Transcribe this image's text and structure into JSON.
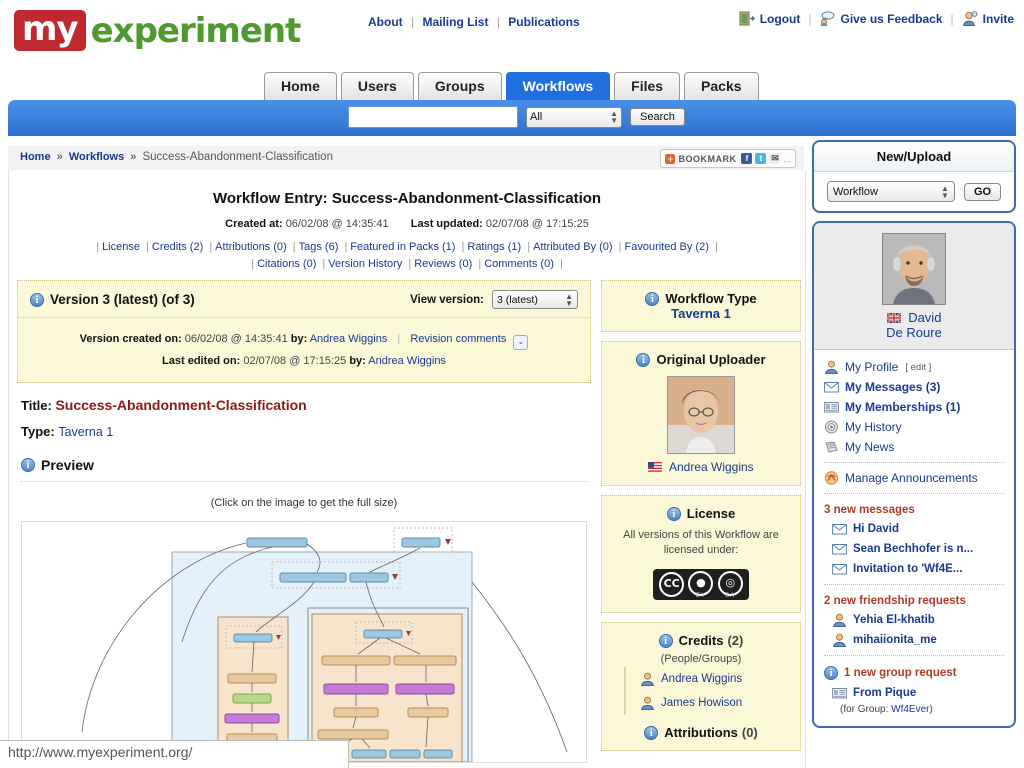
{
  "header": {
    "logo_my": "my",
    "logo_experiment": "experiment",
    "center_nav": [
      "About",
      "Mailing List",
      "Publications"
    ],
    "right_nav": [
      {
        "label": "Logout",
        "icon": "logout-icon"
      },
      {
        "label": "Give us Feedback",
        "icon": "feedback-icon"
      },
      {
        "label": "Invite",
        "icon": "invite-icon"
      }
    ]
  },
  "tabs": [
    {
      "label": "Home",
      "active": false
    },
    {
      "label": "Users",
      "active": false
    },
    {
      "label": "Groups",
      "active": false
    },
    {
      "label": "Workflows",
      "active": true
    },
    {
      "label": "Files",
      "active": false
    },
    {
      "label": "Packs",
      "active": false
    }
  ],
  "search": {
    "value": "",
    "placeholder": "",
    "scope": "All",
    "button": "Search"
  },
  "breadcrumb": {
    "home": "Home",
    "section": "Workflows",
    "current": "Success-Abandonment-Classification",
    "separator": "»"
  },
  "bookmark": {
    "label": "BOOKMARK",
    "plus": "+",
    "facebook": "f",
    "twitter": "t",
    "email": "✉",
    "more": "..."
  },
  "entry": {
    "heading": "Workflow Entry: Success-Abandonment-Classification",
    "created_label": "Created at:",
    "created_value": "06/02/08 @ 14:35:41",
    "updated_label": "Last updated:",
    "updated_value": "02/07/08 @ 17:15:25",
    "meta_links_row1": [
      "License",
      "Credits (2)",
      "Attributions (0)",
      "Tags (6)",
      "Featured in Packs (1)",
      "Ratings (1)",
      "Attributed By (0)",
      "Favourited By (2)"
    ],
    "meta_links_row2": [
      "Citations (0)",
      "Version History",
      "Reviews (0)",
      "Comments (0)"
    ]
  },
  "version_panel": {
    "title": "Version 3 (latest) (of 3)",
    "view_version_label": "View version:",
    "selected_version": "3 (latest)",
    "created_label": "Version created on:",
    "created_value": "06/02/08 @ 14:35:41",
    "created_by_label": "by:",
    "created_by": "Andrea Wiggins",
    "revision_comments": "Revision comments",
    "edited_label": "Last edited on:",
    "edited_value": "02/07/08 @ 17:15:25",
    "edited_by_label": "by:",
    "edited_by": "Andrea Wiggins"
  },
  "details": {
    "title_label": "Title:",
    "title_value": "Success-Abandonment-Classification",
    "type_label": "Type:",
    "type_value": "Taverna 1",
    "preview_heading": "Preview",
    "click_hint": "(Click on the image to get the full size)"
  },
  "side_panels": {
    "workflow_type": {
      "heading": "Workflow Type",
      "value": "Taverna 1"
    },
    "original_uploader": {
      "heading": "Original Uploader",
      "name": "Andrea Wiggins",
      "flag": "us-flag-icon"
    },
    "license": {
      "heading": "License",
      "text": "All versions of this Workflow are licensed under:",
      "badge": "CC",
      "badge_by": "BY",
      "badge_sa": "SA"
    },
    "credits": {
      "heading": "Credits",
      "count": "(2)",
      "subtitle": "(People/Groups)",
      "people": [
        "Andrea Wiggins",
        "James Howison"
      ]
    },
    "attributions": {
      "heading": "Attributions",
      "count": "(0)"
    }
  },
  "sidebar": {
    "new_upload": {
      "title": "New/Upload",
      "selected": "Workflow",
      "go": "GO"
    },
    "profile": {
      "name_line1": "David",
      "name_line2": "De Roure",
      "flag": "uk-flag-icon"
    },
    "menu": [
      {
        "label": "My Profile",
        "edit": "[ edit ]",
        "icon": "user-icon",
        "bold": false
      },
      {
        "label": "My Messages (3)",
        "icon": "envelope-icon",
        "bold": true
      },
      {
        "label": "My Memberships (1)",
        "icon": "card-icon",
        "bold": true
      },
      {
        "label": "My History",
        "icon": "history-icon",
        "bold": false
      },
      {
        "label": "My News",
        "icon": "news-icon",
        "bold": false
      }
    ],
    "manage_announcements": {
      "label": "Manage Announcements",
      "icon": "announcement-icon"
    },
    "new_messages": {
      "heading": "3 new messages",
      "items": [
        "Hi David",
        "Sean Bechhofer is n...",
        "Invitation to 'Wf4E..."
      ]
    },
    "friendship_requests": {
      "heading": "2 new friendship requests",
      "items": [
        "Yehia El-khatib",
        "mihaiionita_me"
      ]
    },
    "group_request": {
      "heading": "1 new group request",
      "from": "From Pique",
      "for_group_label": "(for Group:",
      "group_name": "Wf4Ever",
      "close_paren": ")"
    }
  },
  "status_bar": {
    "url": "http://www.myexperiment.org/"
  },
  "colors": {
    "brand_red": "#bf2a2f",
    "brand_green": "#4e9a2f",
    "link_blue": "#1a3a8f",
    "tab_active": "#1f6fe0",
    "panel_yellow": "#fbf8d8",
    "alert_red": "#b03a2a",
    "title_maroon": "#8a1a1a"
  }
}
